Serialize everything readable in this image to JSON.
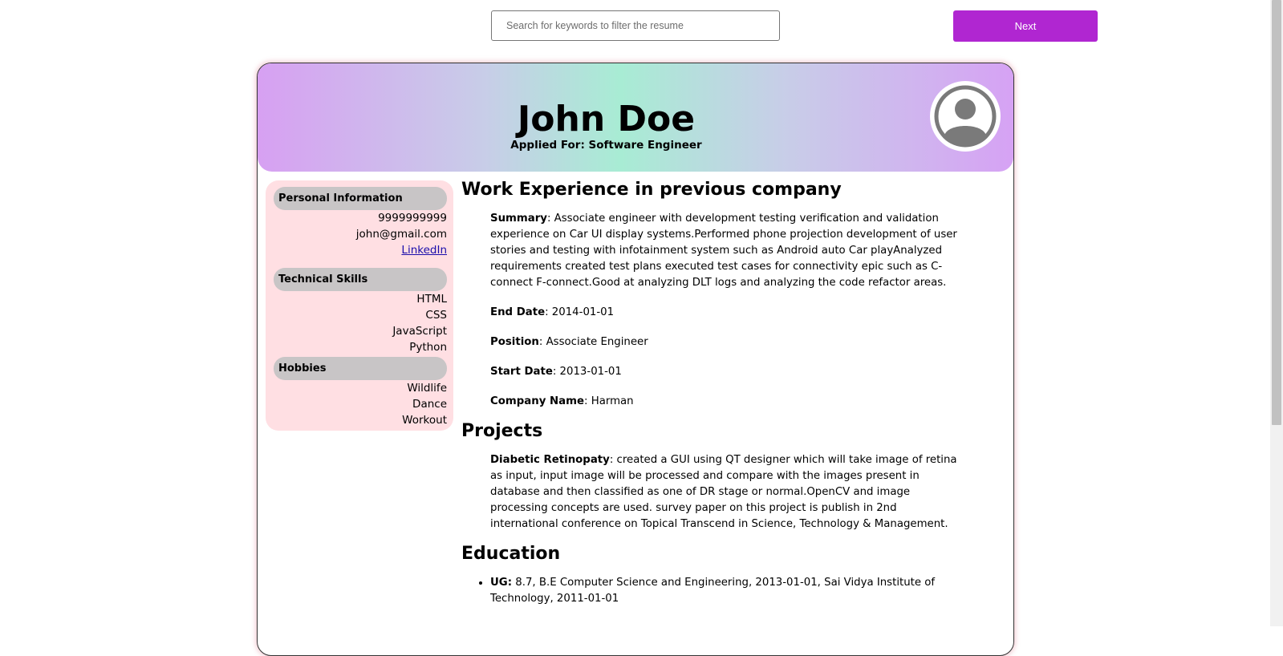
{
  "search": {
    "placeholder": "Search for keywords to filter the resume"
  },
  "next_button": {
    "label": "Next"
  },
  "header": {
    "name": "John Doe",
    "applied_for": "Applied For: Software Engineer"
  },
  "sidebar": {
    "personal": {
      "title": "Personal Information",
      "phone": "9999999999",
      "email": "john@gmail.com",
      "linkedin": "LinkedIn"
    },
    "skills": {
      "title": "Technical Skills",
      "items": [
        "HTML",
        "CSS",
        "JavaScript",
        "Python"
      ]
    },
    "hobbies": {
      "title": "Hobbies",
      "items": [
        "Wildlife",
        "Dance",
        "Workout"
      ]
    }
  },
  "work": {
    "title": "Work Experience in previous company",
    "summary_label": "Summary",
    "summary": ": Associate engineer with development testing verification and validation experience on Car UI display systems.Performed phone projection development of user stories and testing with infotainment system such as Android auto Car playAnalyzed requirements created test plans executed test cases for connectivity epic such as C-connect F-connect.Good at analyzing DLT logs and analyzing the code refactor areas.",
    "end_date_label": "End Date",
    "end_date": ": 2014-01-01",
    "position_label": "Position",
    "position": ": Associate Engineer",
    "start_date_label": "Start Date",
    "start_date": ": 2013-01-01",
    "company_label": "Company Name",
    "company": ": Harman"
  },
  "projects": {
    "title": "Projects",
    "name": "Diabetic Retinopaty",
    "description": ": created a GUI using QT designer which will take image of retina as input, input image will be processed and compare with the images present in database and then classified as one of DR stage or normal.OpenCV and image processing concepts are used. survey paper on this project is publish in 2nd international conference on Topical Transcend in Science, Technology & Management."
  },
  "education": {
    "title": "Education",
    "ug_label": "UG:",
    "ug": " 8.7, B.E Computer Science and Engineering, 2013-01-01, Sai Vidya Institute of Technology, 2011-01-01"
  },
  "colors": {
    "accent": "#b026d1",
    "sidebar_bg": "#ffdfe3",
    "section_pill": "#c8c5c6"
  }
}
